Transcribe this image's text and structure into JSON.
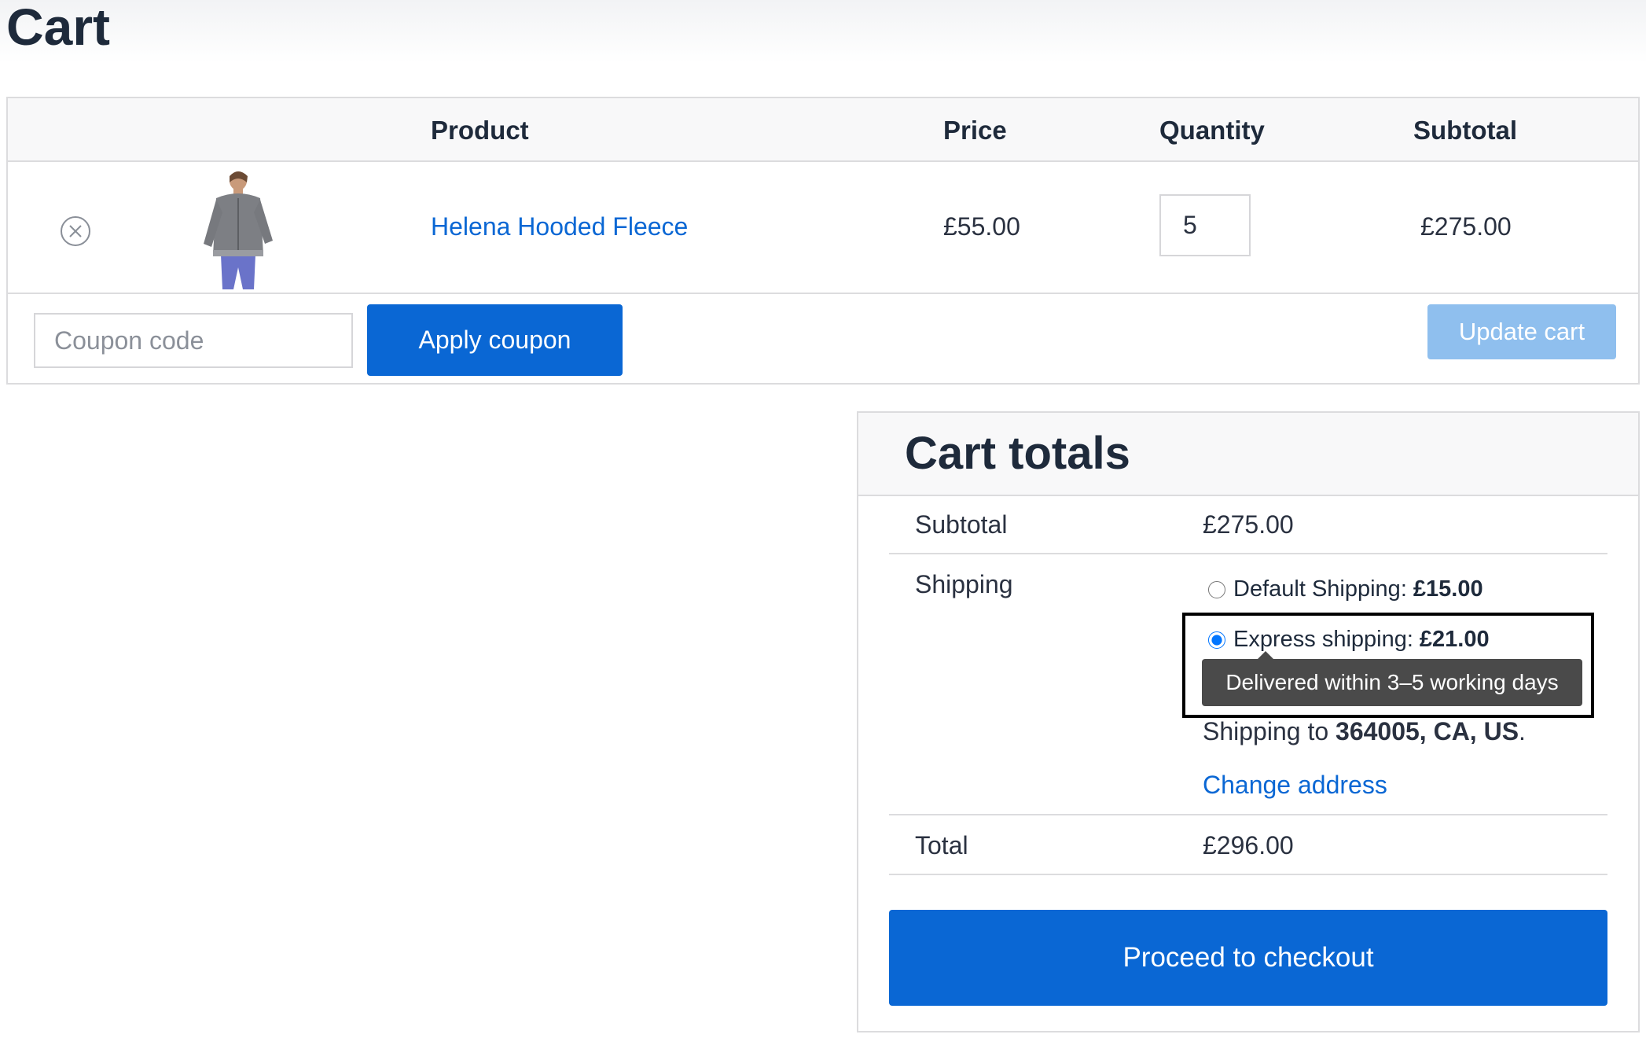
{
  "page": {
    "title": "Cart"
  },
  "cart_table": {
    "headers": {
      "product": "Product",
      "price": "Price",
      "quantity": "Quantity",
      "subtotal": "Subtotal"
    },
    "items": [
      {
        "name": "Helena Hooded Fleece",
        "price": "£55.00",
        "quantity": "5",
        "subtotal": "£275.00",
        "remove_icon": "remove-circle-x-icon"
      }
    ]
  },
  "actions": {
    "coupon_placeholder": "Coupon code",
    "apply_coupon_label": "Apply coupon",
    "update_cart_label": "Update cart"
  },
  "totals": {
    "title": "Cart totals",
    "subtotal_label": "Subtotal",
    "subtotal_value": "£275.00",
    "shipping_label": "Shipping",
    "shipping_options": [
      {
        "label": "Default Shipping:",
        "price": "£15.00",
        "selected": false
      },
      {
        "label": "Express shipping:",
        "price": "£21.00",
        "selected": true
      }
    ],
    "tooltip": "Delivered within 3–5 working days",
    "shipping_to_prefix": "Shipping to",
    "shipping_to_destination": "364005, CA, US",
    "shipping_to_suffix": ".",
    "change_address_label": "Change address",
    "total_label": "Total",
    "total_value": "£296.00",
    "checkout_label": "Proceed to checkout"
  },
  "colors": {
    "accent": "#0a67d4",
    "update_cart_disabled": "#8fbfee",
    "tooltip_background": "#4a4a4a",
    "highlight_border": "#000000",
    "heading_text": "#1e2a3b"
  }
}
